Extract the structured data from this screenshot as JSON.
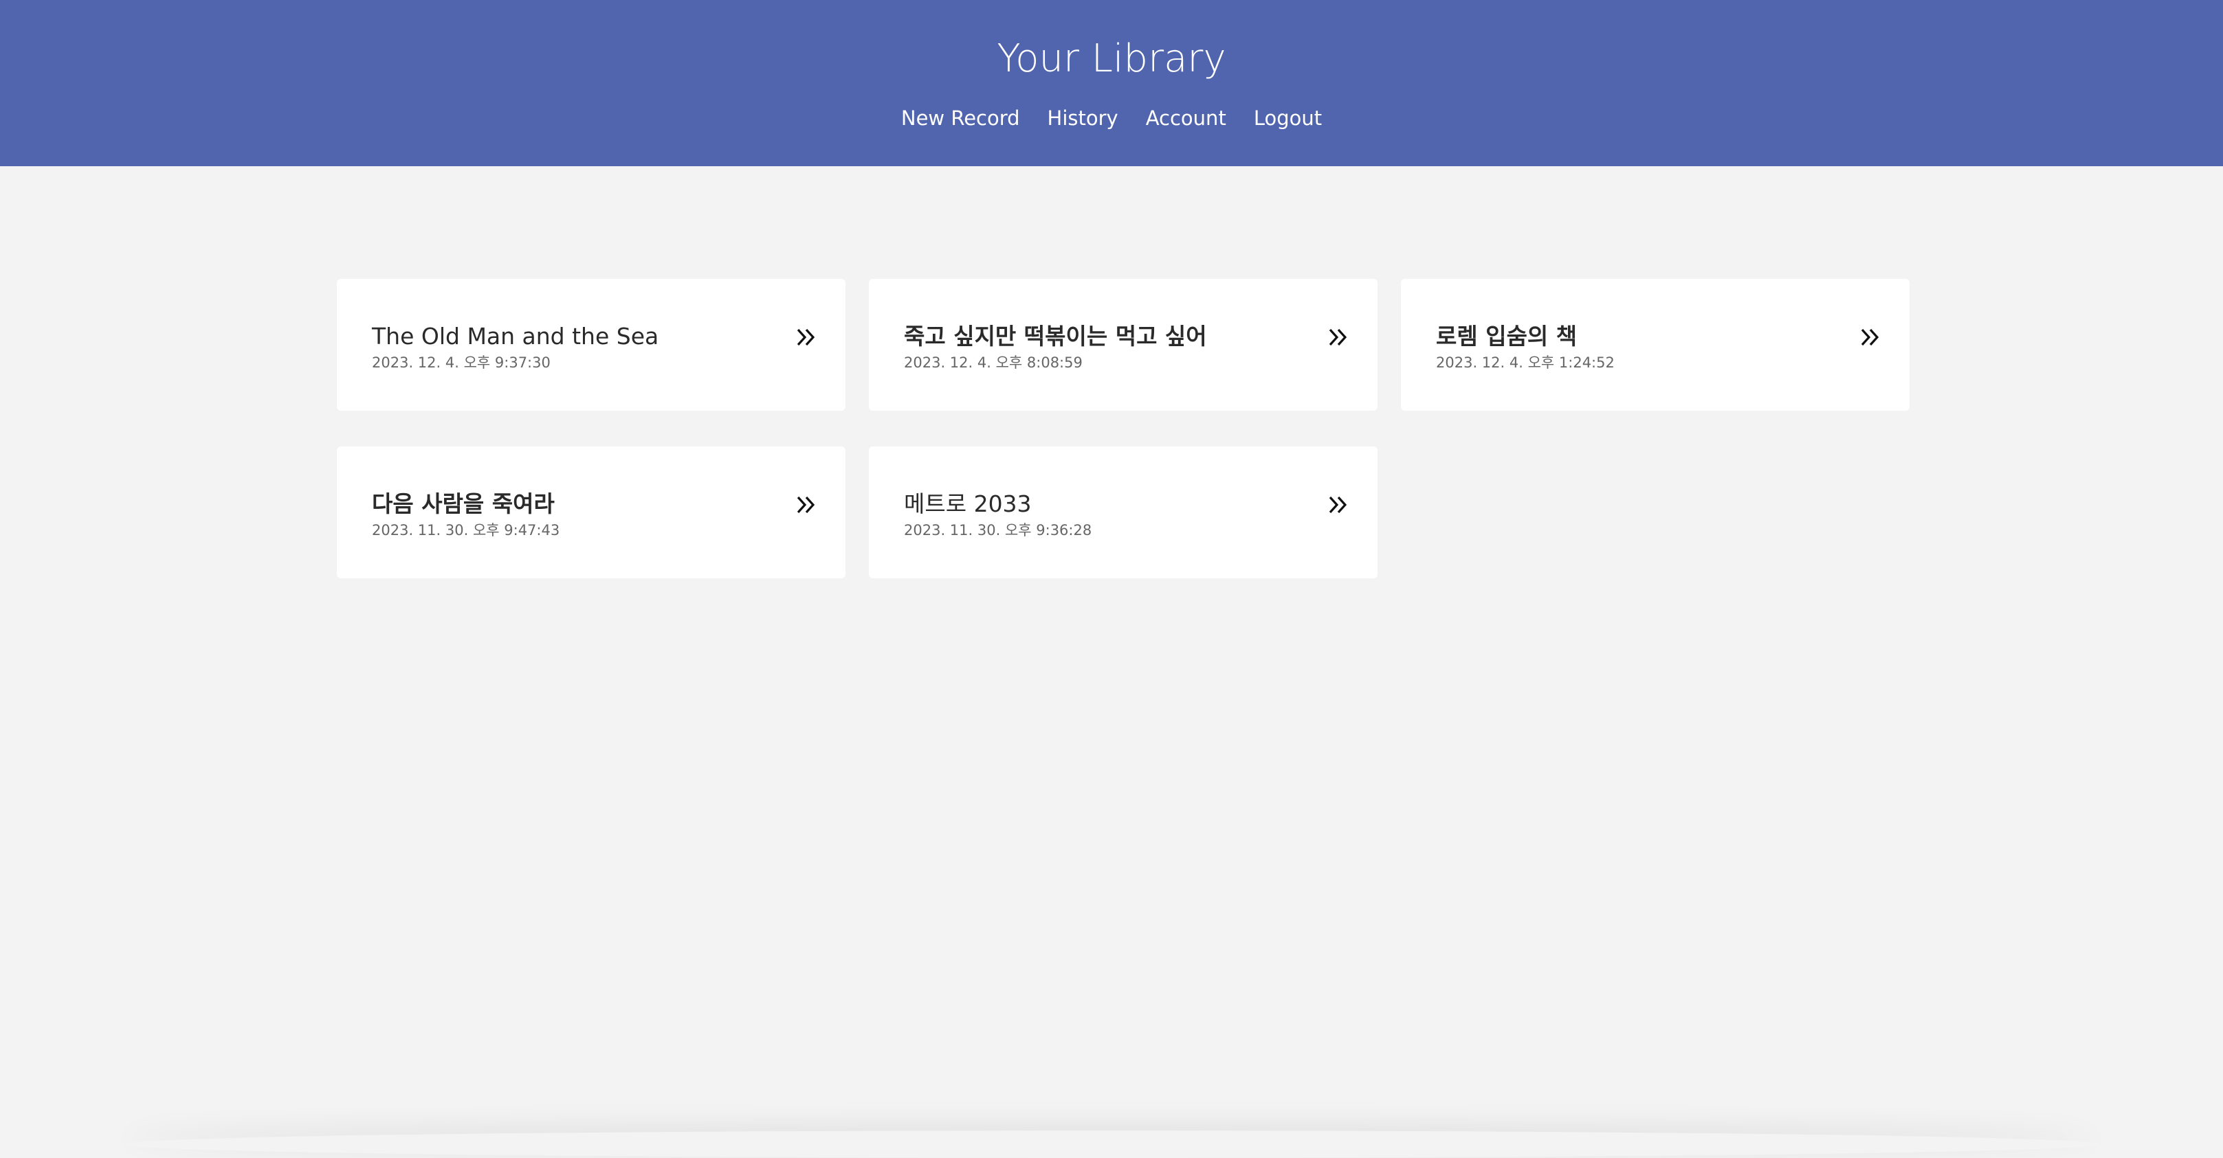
{
  "header": {
    "title": "Your Library",
    "nav": [
      "New Record",
      "History",
      "Account",
      "Logout"
    ]
  },
  "colors": {
    "header_bg": "#5065ad",
    "page_bg": "#f3f3f3",
    "card_bg": "#ffffff"
  },
  "records": [
    {
      "title": "The Old Man and the Sea",
      "date": "2023. 12. 4. 오후 9:37:30",
      "icon": "double-chevron-right-icon"
    },
    {
      "title": "죽고 싶지만 떡볶이는 먹고 싶어",
      "date": "2023. 12. 4. 오후 8:08:59",
      "icon": "double-chevron-right-icon"
    },
    {
      "title": "로렘 입숨의 책",
      "date": "2023. 12. 4. 오후 1:24:52",
      "icon": "double-chevron-right-icon"
    },
    {
      "title": "다음 사람을 죽여라",
      "date": "2023. 11. 30. 오후 9:47:43",
      "icon": "double-chevron-right-icon"
    },
    {
      "title": "메트로 2033",
      "date": "2023. 11. 30. 오후 9:36:28",
      "icon": "double-chevron-right-icon"
    }
  ]
}
